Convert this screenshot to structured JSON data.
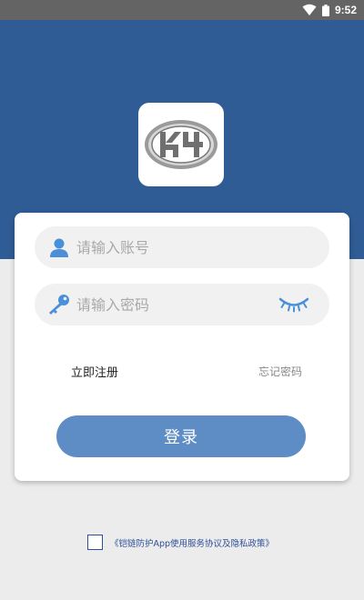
{
  "status_bar": {
    "time": "9:52",
    "icons": [
      "wifi-icon",
      "battery-icon"
    ]
  },
  "logo": {
    "text": "K4"
  },
  "form": {
    "account_placeholder": "请输入账号",
    "password_placeholder": "请输入密码",
    "register_label": "立即注册",
    "forgot_label": "忘记密码",
    "login_label": "登录"
  },
  "agreement": {
    "text": "《铠链防护App使用服务协议及隐私政策》",
    "checked": false
  },
  "colors": {
    "header_blue": "#2f5c95",
    "button_blue": "#5d8dc4",
    "icon_blue": "#4a90d9",
    "link_blue": "#2f4f9a"
  }
}
